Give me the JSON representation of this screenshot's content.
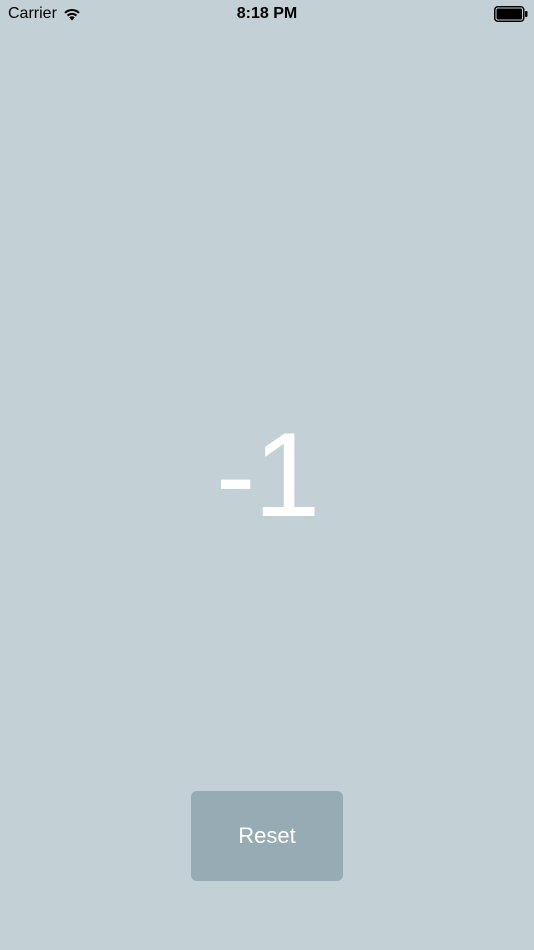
{
  "status_bar": {
    "carrier": "Carrier",
    "time": "8:18 PM",
    "wifi_icon": "wifi-icon",
    "battery_icon": "battery-icon"
  },
  "counter": {
    "value": "-1"
  },
  "reset_button": {
    "label": "Reset"
  },
  "colors": {
    "background": "#c3d0d6",
    "button": "#96abb3",
    "text": "#ffffff"
  }
}
